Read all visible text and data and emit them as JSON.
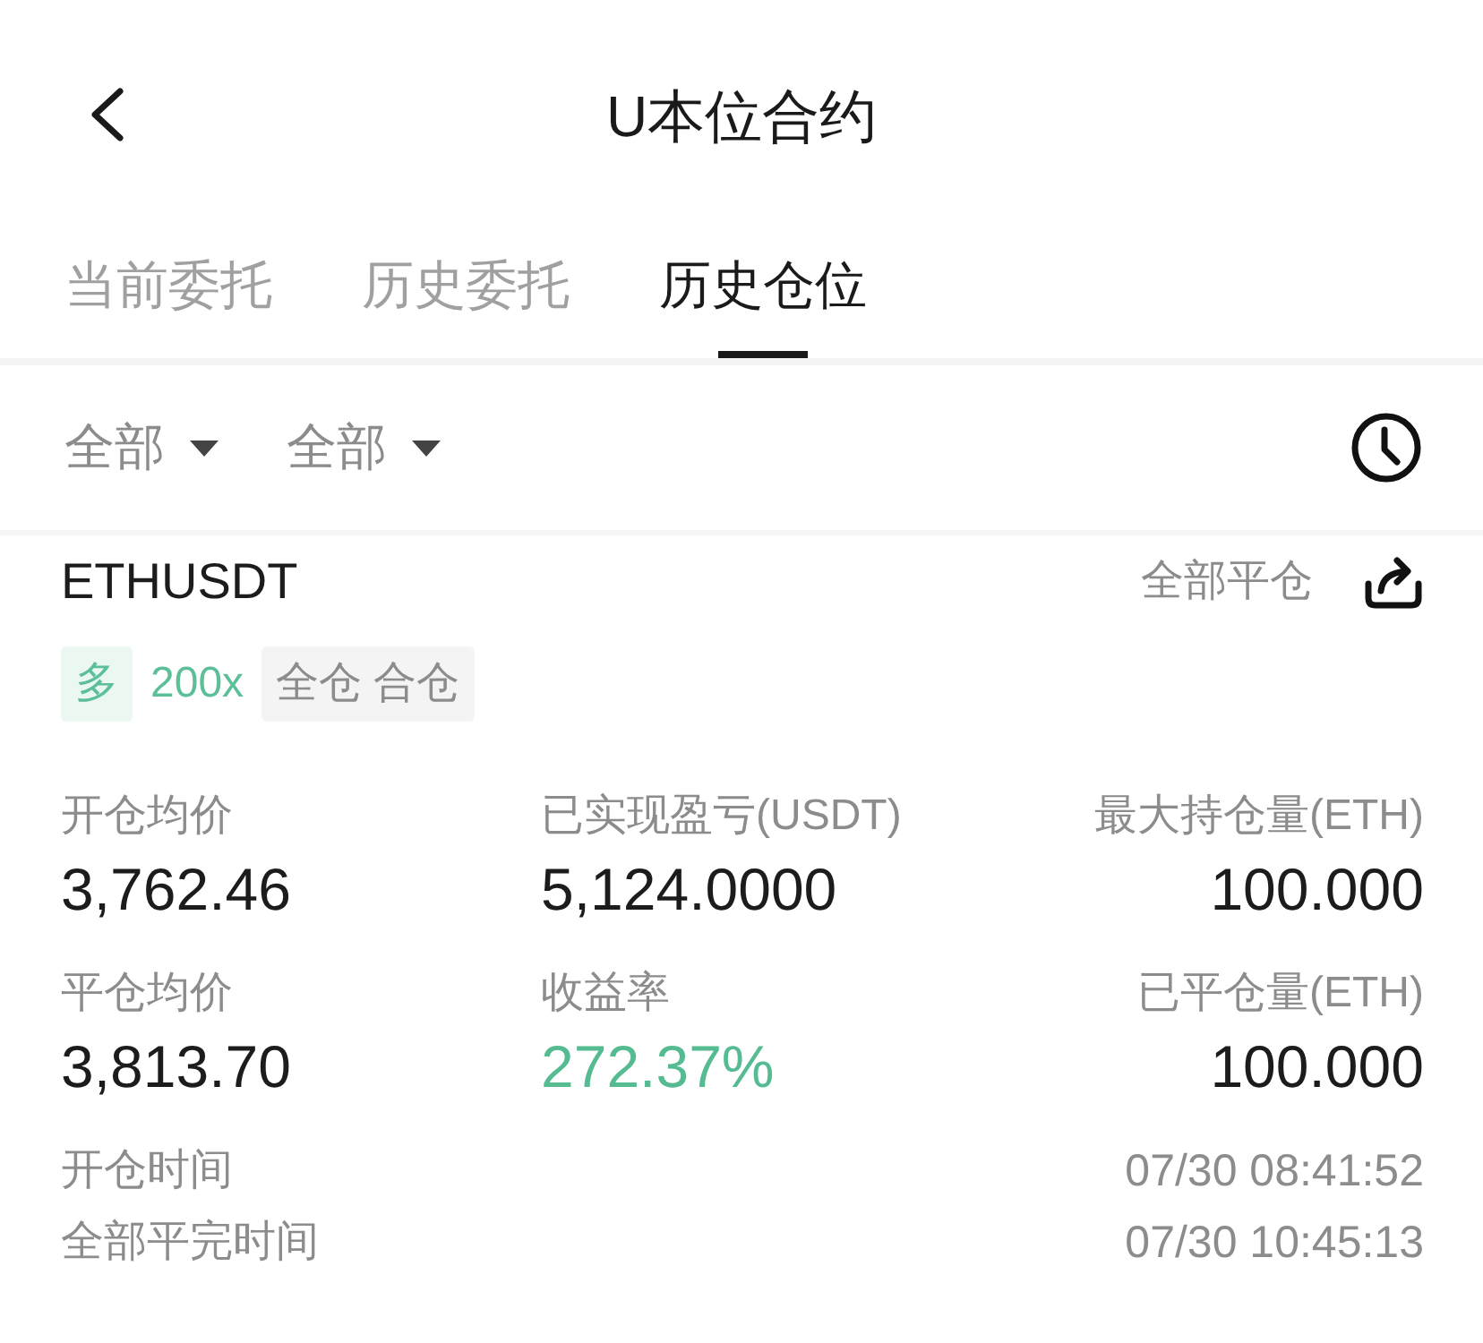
{
  "header": {
    "title": "U本位合约"
  },
  "tabs": [
    {
      "label": "当前委托",
      "selected": false
    },
    {
      "label": "历史委托",
      "selected": false
    },
    {
      "label": "历史仓位",
      "selected": true
    }
  ],
  "filters": [
    {
      "label": "全部"
    },
    {
      "label": "全部"
    }
  ],
  "position": {
    "symbol": "ETHUSDT",
    "close_all": "全部平仓",
    "tags": [
      {
        "kind": "long",
        "text": "多"
      },
      {
        "kind": "leverage",
        "text": "200x"
      },
      {
        "kind": "margin",
        "text": "全仓 合仓"
      }
    ],
    "stats": [
      {
        "label": "开仓均价",
        "value": "3,762.46",
        "kind": "plain"
      },
      {
        "label": "已实现盈亏(USDT)",
        "value": "5,124.0000",
        "kind": "plain"
      },
      {
        "label": "最大持仓量(ETH)",
        "value": "100.000",
        "kind": "plain"
      },
      {
        "label": "平仓均价",
        "value": "3,813.70",
        "kind": "plain"
      },
      {
        "label": "收益率",
        "value": "272.37%",
        "kind": "gain"
      },
      {
        "label": "已平仓量(ETH)",
        "value": "100.000",
        "kind": "plain"
      }
    ],
    "times": [
      {
        "label": "开仓时间",
        "value": "07/30 08:41:52"
      },
      {
        "label": "全部平完时间",
        "value": "07/30 10:45:13"
      }
    ]
  }
}
